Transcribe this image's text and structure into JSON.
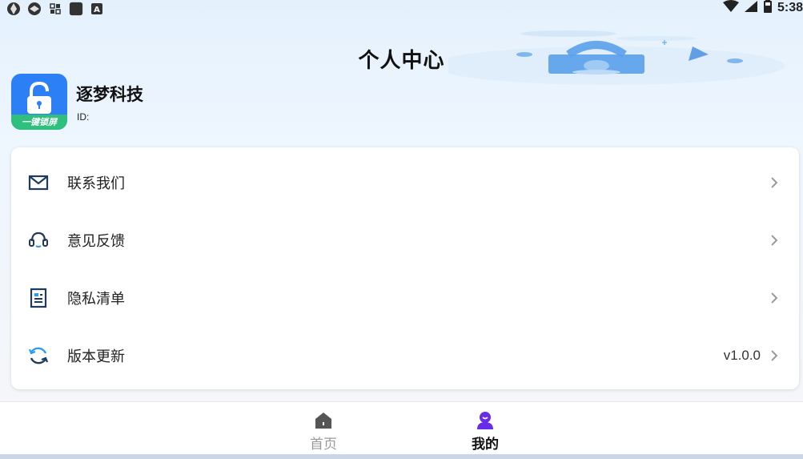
{
  "status_bar": {
    "time": "5:38",
    "left_icons": [
      "app-icon-1",
      "app-icon-2",
      "grid-icon",
      "square-app-icon",
      "font-icon"
    ],
    "right_icons": [
      "wifi-icon",
      "signal-icon",
      "battery-icon"
    ]
  },
  "header": {
    "title": "个人中心"
  },
  "profile": {
    "logo_caption": "一键锁屏",
    "name": "逐梦科技",
    "id_label": "ID:"
  },
  "menu": {
    "items": [
      {
        "label": "联系我们",
        "icon": "mail-icon",
        "value": ""
      },
      {
        "label": "意见反馈",
        "icon": "headset-icon",
        "value": ""
      },
      {
        "label": "隐私清单",
        "icon": "document-icon",
        "value": ""
      },
      {
        "label": "版本更新",
        "icon": "refresh-icon",
        "value": "v1.0.0"
      }
    ]
  },
  "bottom_nav": {
    "tabs": [
      {
        "label": "首页",
        "icon": "home-icon",
        "active": false
      },
      {
        "label": "我的",
        "icon": "user-icon",
        "active": true
      }
    ]
  },
  "colors": {
    "accent": "#6a2be8",
    "logo_blue": "#2d7ff5",
    "logo_green": "#2ec07c"
  }
}
